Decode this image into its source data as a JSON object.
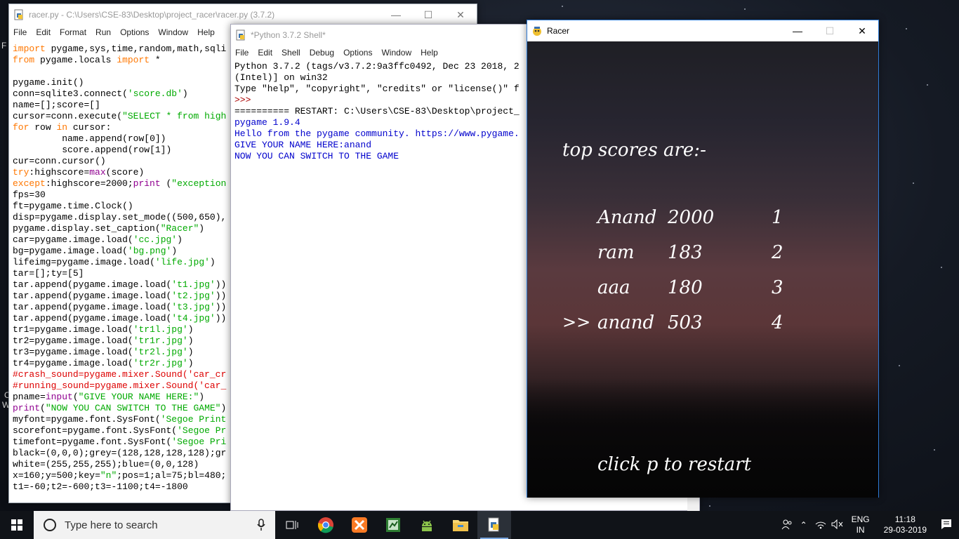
{
  "editor": {
    "title": "racer.py - C:\\Users\\CSE-83\\Desktop\\project_racer\\racer.py (3.7.2)",
    "menu": [
      "File",
      "Edit",
      "Format",
      "Run",
      "Options",
      "Window",
      "Help"
    ],
    "lines": [
      "import pygame,sys,time,random,math,sqli",
      "from pygame.locals import *",
      "",
      "pygame.init()",
      "conn=sqlite3.connect('score.db')",
      "name=[];score=[]",
      "cursor=conn.execute(\"SELECT * from high",
      "for row in cursor:",
      "         name.append(row[0])",
      "         score.append(row[1])",
      "cur=conn.cursor()",
      "try:highscore=max(score)",
      "except:highscore=2000;print (\"exception",
      "fps=30",
      "ft=pygame.time.Clock()",
      "disp=pygame.display.set_mode((500,650),",
      "pygame.display.set_caption(\"Racer\")",
      "car=pygame.image.load('cc.jpg')",
      "bg=pygame.image.load('bg.png')",
      "lifeimg=pygame.image.load('life.jpg')",
      "tar=[];ty=[5]",
      "tar.append(pygame.image.load('t1.jpg'))",
      "tar.append(pygame.image.load('t2.jpg'))",
      "tar.append(pygame.image.load('t3.jpg'))",
      "tar.append(pygame.image.load('t4.jpg'))",
      "tr1=pygame.image.load('tr1l.jpg')",
      "tr2=pygame.image.load('tr1r.jpg')",
      "tr3=pygame.image.load('tr2l.jpg')",
      "tr4=pygame.image.load('tr2r.jpg')",
      "#crash_sound=pygame.mixer.Sound('car_cr",
      "#running_sound=pygame.mixer.Sound('car_",
      "pname=input(\"GIVE YOUR NAME HERE:\")",
      "print(\"NOW YOU CAN SWITCH TO THE GAME\")",
      "myfont=pygame.font.SysFont('Segoe Print",
      "scorefont=pygame.font.SysFont('Segoe Pr",
      "timefont=pygame.font.SysFont('Segoe Pri",
      "black=(0,0,0);grey=(128,128,128,128);gr",
      "white=(255,255,255);blue=(0,0,128)",
      "x=160;y=500;key=\"n\";pos=1;al=75;bl=480;",
      "t1=-60;t2=-600;t3=-1100;t4=-1800"
    ]
  },
  "shell": {
    "title": "*Python 3.7.2 Shell*",
    "menu": [
      "File",
      "Edit",
      "Shell",
      "Debug",
      "Options",
      "Window",
      "Help"
    ],
    "banner1": "Python 3.7.2 (tags/v3.7.2:9a3ffc0492, Dec 23 2018, 2",
    "banner2": "(Intel)] on win32",
    "banner3": "Type \"help\", \"copyright\", \"credits\" or \"license()\" f",
    "prompt": ">>>",
    "restart": "========== RESTART: C:\\Users\\CSE-83\\Desktop\\project_",
    "out1": "pygame 1.9.4",
    "out2": "Hello from the pygame community. https://www.pygame.",
    "out3": "GIVE YOUR NAME HERE:anand",
    "out4": "NOW YOU CAN SWITCH TO THE GAME"
  },
  "racer": {
    "title": "Racer",
    "heading": "top scores are:-",
    "scores": [
      {
        "marker": "",
        "name": "Anand",
        "score": "2000",
        "rank": "1"
      },
      {
        "marker": "",
        "name": "ram",
        "score": "183",
        "rank": "2"
      },
      {
        "marker": "",
        "name": "aaa",
        "score": "180",
        "rank": "3"
      },
      {
        "marker": ">>",
        "name": "anand",
        "score": "503",
        "rank": "4"
      }
    ],
    "restart_hint": "click p to restart"
  },
  "desktop_edge": {
    "a": "F",
    "b": "C",
    "c": "W"
  },
  "taskbar": {
    "search_placeholder": "Type here to search",
    "lang_top": "ENG",
    "lang_bottom": "IN",
    "time": "11:18",
    "date": "29-03-2019"
  }
}
